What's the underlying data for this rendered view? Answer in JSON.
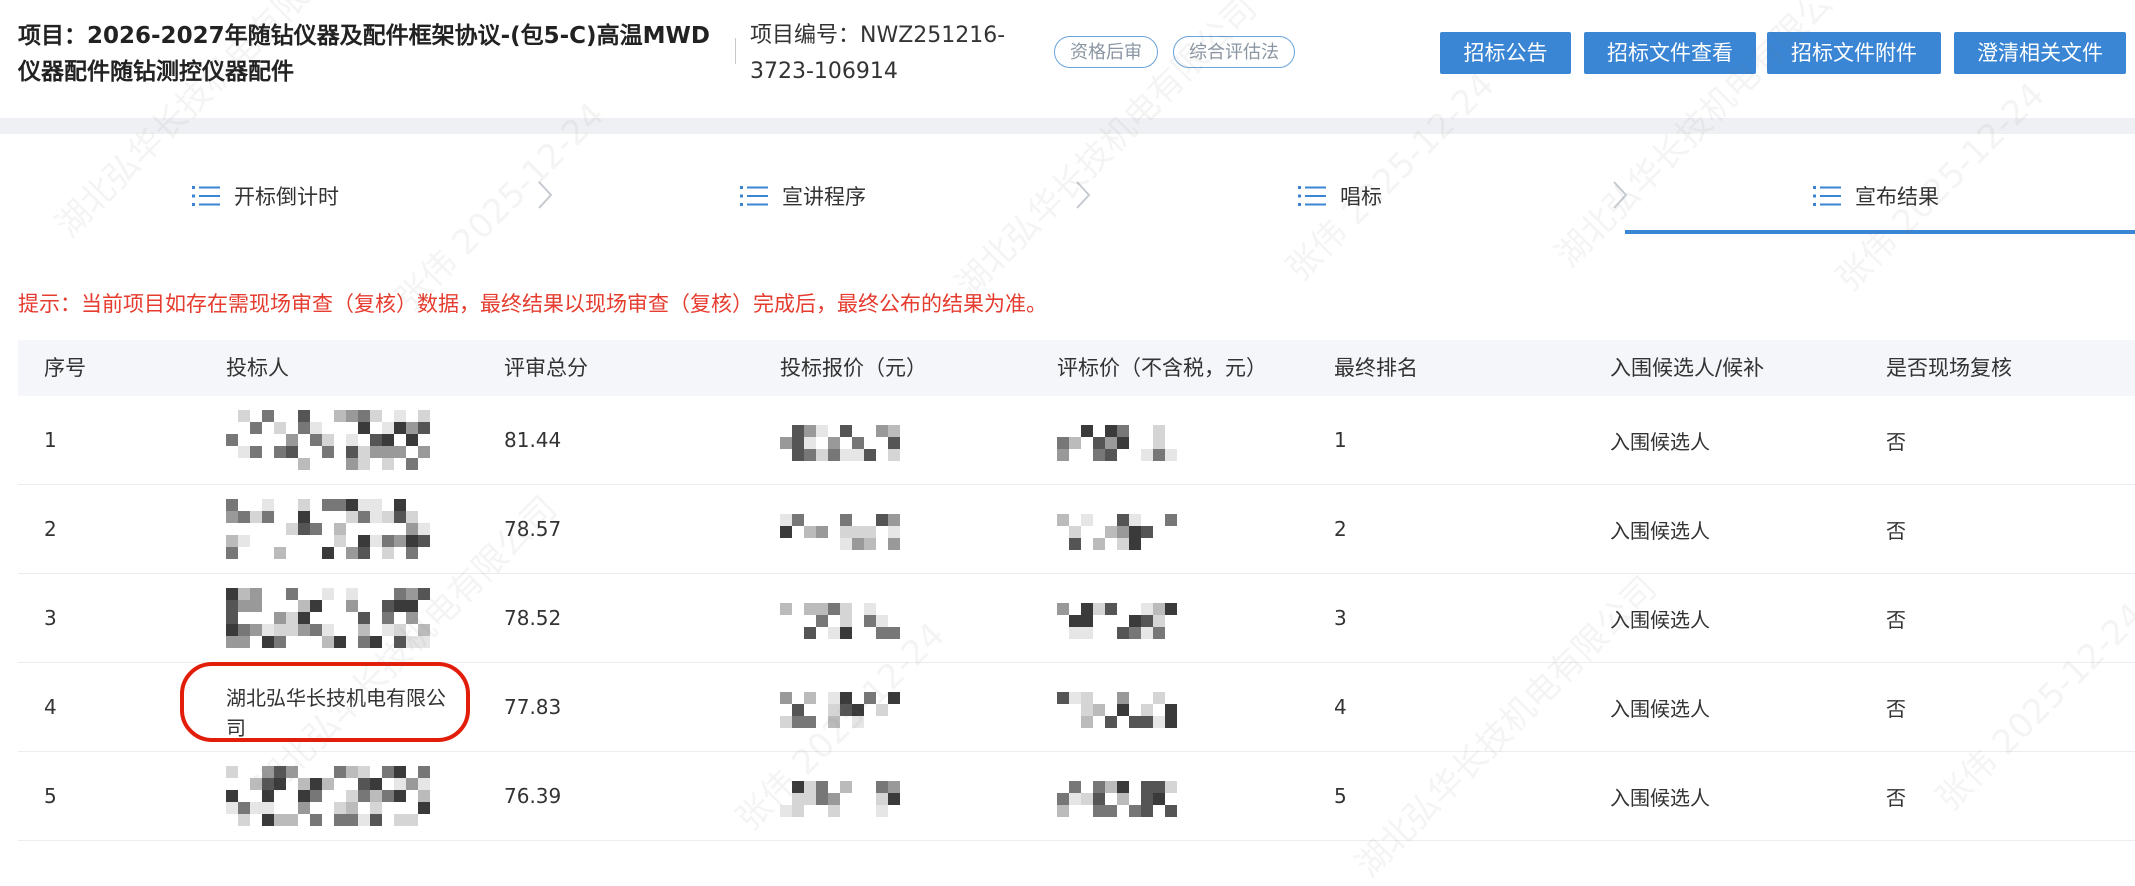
{
  "header": {
    "title": "项目：2026-2027年随钻仪器及配件框架协议-(包5-C)高温MWD仪器配件随钻测控仪器配件",
    "project_no": "项目编号：NWZ251216-3723-106914",
    "tags": [
      "资格后审",
      "综合评估法"
    ],
    "buttons": [
      "招标公告",
      "招标文件查看",
      "招标文件附件",
      "澄清相关文件"
    ]
  },
  "steps": [
    "开标倒计时",
    "宣讲程序",
    "唱标",
    "宣布结果"
  ],
  "active_step": "宣布结果",
  "notice": "提示：当前项目如存在需现场审查（复核）数据，最终结果以现场审查（复核）完成后，最终公布的结果为准。",
  "table": {
    "columns": [
      "序号",
      "投标人",
      "评审总分",
      "投标报价（元）",
      "评标价（不含税，元）",
      "最终排名",
      "入围候选人/候补",
      "是否现场复核"
    ],
    "rows": [
      {
        "no": "1",
        "bidder": "",
        "score": "81.44",
        "rank": "1",
        "status": "入围候选人",
        "review": "否"
      },
      {
        "no": "2",
        "bidder": "",
        "score": "78.57",
        "rank": "2",
        "status": "入围候选人",
        "review": "否"
      },
      {
        "no": "3",
        "bidder": "",
        "score": "78.52",
        "rank": "3",
        "status": "入围候选人",
        "review": "否"
      },
      {
        "no": "4",
        "bidder": "湖北弘华长技机电有限公司",
        "score": "77.83",
        "rank": "4",
        "status": "入围候选人",
        "review": "否"
      },
      {
        "no": "5",
        "bidder": "",
        "score": "76.39",
        "rank": "5",
        "status": "入围候选人",
        "review": "否"
      }
    ]
  },
  "watermark": [
    "湖北弘华长技机电有限公司",
    "张伟 2025-12-24"
  ],
  "colors": {
    "accent": "#3a86d4",
    "notice": "#e63c2f",
    "highlight": "#e21d0a"
  }
}
